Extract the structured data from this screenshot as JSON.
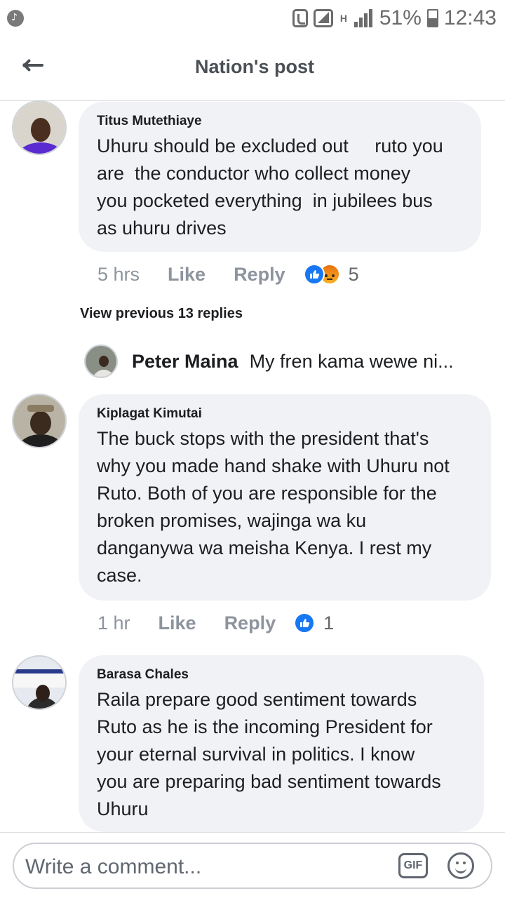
{
  "status_bar": {
    "battery": "51%",
    "time": "12:43",
    "network": "H"
  },
  "header": {
    "title": "Nation's post",
    "back_icon": "back-arrow-icon"
  },
  "comments": [
    {
      "author": "Titus Mutethiaye",
      "text_lines": [
        "Uhuru should be excluded out     ruto you",
        "are  the conductor who collect money",
        "you pocketed everything  in jubilees bus",
        "as uhuru drives"
      ],
      "time": "5 hrs",
      "like_label": "Like",
      "reply_label": "Reply",
      "reactions": [
        "like",
        "angry"
      ],
      "reaction_count": "5"
    },
    {
      "author": "Kiplagat Kimutai",
      "text_lines": [
        "The buck stops with the president that's",
        "why you made hand shake with Uhuru not",
        "Ruto. Both of you are responsible for the",
        "broken promises, wajinga wa ku",
        "danganywa wa meisha Kenya. I rest my",
        "case."
      ],
      "time": "1 hr",
      "like_label": "Like",
      "reply_label": "Reply",
      "reactions": [
        "like"
      ],
      "reaction_count": "1"
    },
    {
      "author": "Barasa Chales",
      "text_lines": [
        "Raila prepare good sentiment towards",
        "Ruto as he is the incoming President for",
        "your eternal survival in politics. I know",
        "you are preparing bad sentiment towards",
        "Uhuru"
      ]
    }
  ],
  "view_previous": "View previous 13 replies",
  "reply_preview": {
    "author": "Peter Maina",
    "text": "My fren kama wewe ni..."
  },
  "composer": {
    "placeholder": "Write a comment...",
    "gif_label": "GIF",
    "emoji_icon": "smiley-icon"
  },
  "colors": {
    "like_blue": "#1877f2",
    "bubble_bg": "#f0f2f5",
    "meta_gray": "#8d949e"
  }
}
